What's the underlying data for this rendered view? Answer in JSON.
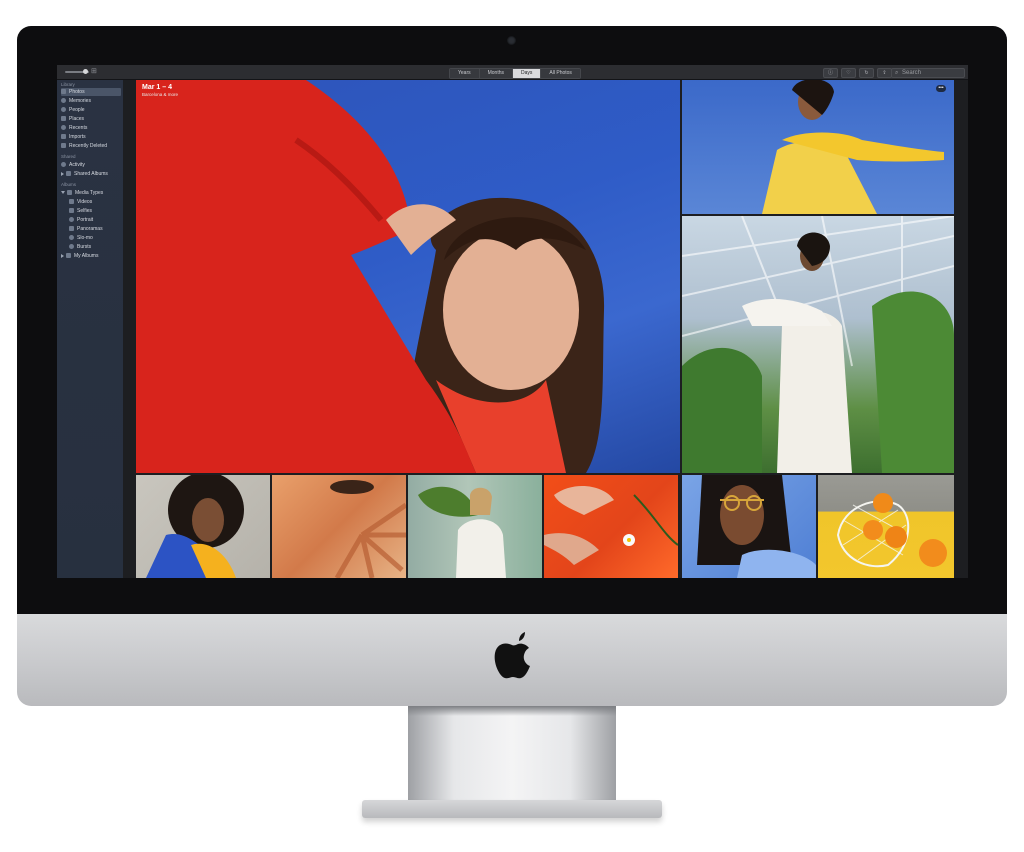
{
  "toolbar": {
    "segments": [
      "Years",
      "Months",
      "Days",
      "All Photos"
    ],
    "active_segment": "Days",
    "search_placeholder": "Search"
  },
  "sidebar": {
    "library_heading": "Library",
    "library_items": [
      "Photos",
      "Memories",
      "People",
      "Places",
      "Recents",
      "Imports",
      "Recently Deleted"
    ],
    "shared_heading": "Shared",
    "shared_items": [
      "Activity",
      "Shared Albums"
    ],
    "albums_heading": "Albums",
    "album_items": [
      "Media Types",
      "Videos",
      "Selfies",
      "Portrait",
      "Panoramas",
      "Slo-mo",
      "Bursts",
      "My Albums"
    ]
  },
  "main": {
    "date_range": "Mar 1 – 4",
    "location": "Barcelona & more",
    "more_label": "•••"
  },
  "colors": {
    "sidebar_bg": "#2a3242",
    "bezel": "#0d0d0f",
    "sky_blue": "#2f5cc7",
    "sweater_red": "#d8241c",
    "accent_yellow": "#f3c72d"
  },
  "icons": [
    "apple-logo-icon",
    "search-icon",
    "grid-icon",
    "more-icon"
  ]
}
